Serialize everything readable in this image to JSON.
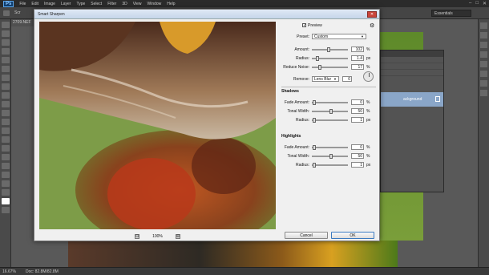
{
  "menubar": {
    "logo": "Ps",
    "items": [
      "File",
      "Edit",
      "Image",
      "Layer",
      "Type",
      "Select",
      "Filter",
      "3D",
      "View",
      "Window",
      "Help"
    ],
    "controls": [
      "–",
      "□",
      "✕"
    ]
  },
  "optionsbar": {
    "text": "Scr"
  },
  "workspace": {
    "value": "Essentials"
  },
  "document": {
    "tab_label": "2709.NEF"
  },
  "layers_panel": {
    "header": "",
    "layer_name": "ackground"
  },
  "statusbar": {
    "zoom": "16.67%",
    "doc_info": "Doc: 82.8M/82.8M"
  },
  "dialog": {
    "title": "Smart Sharpen",
    "close_label": "✕",
    "preview_label": "Preview",
    "preview_checked": true,
    "preset_label": "Preset:",
    "preset_value": "Custom",
    "amount_label": "Amount:",
    "amount_value": "102",
    "amount_unit": "%",
    "radius_label": "Radius:",
    "radius_value": "1.4",
    "radius_unit": "px",
    "reduce_noise_label": "Reduce Noise:",
    "reduce_noise_value": "17",
    "reduce_noise_unit": "%",
    "remove_label": "Remove:",
    "remove_value": "Lens Blur",
    "angle_value": "0",
    "shadows": {
      "heading": "Shadows",
      "fade_label": "Fade Amount:",
      "fade_value": "0",
      "fade_unit": "%",
      "tonal_label": "Tonal Width:",
      "tonal_value": "50",
      "tonal_unit": "%",
      "radius_label": "Radius:",
      "radius_value": "1",
      "radius_unit": "px"
    },
    "highlights": {
      "heading": "Highlights",
      "fade_label": "Fade Amount:",
      "fade_value": "0",
      "fade_unit": "%",
      "tonal_label": "Tonal Width:",
      "tonal_value": "50",
      "tonal_unit": "%",
      "radius_label": "Radius:",
      "radius_value": "1",
      "radius_unit": "px"
    },
    "zoom_out": "⊟",
    "zoom_level": "100%",
    "zoom_in": "⊞",
    "cancel_label": "Cancel",
    "ok_label": "OK"
  }
}
